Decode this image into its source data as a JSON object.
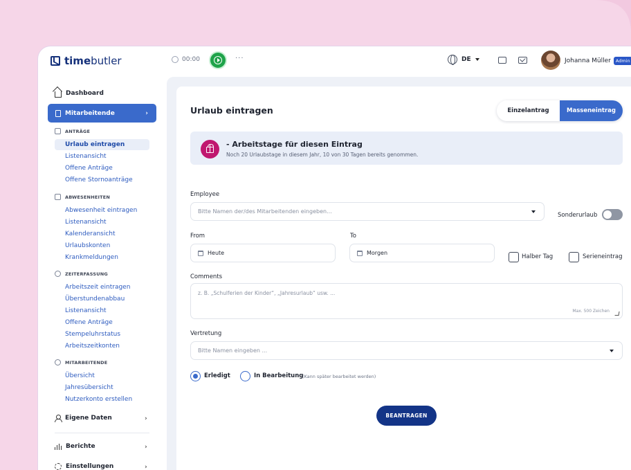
{
  "brand": {
    "bold": "time",
    "light": "butler"
  },
  "header": {
    "timer": "00:00",
    "more": "···",
    "language": "DE",
    "user_name": "Johanna Müller",
    "user_badge": "Admin"
  },
  "sidebar": {
    "dashboard": "Dashboard",
    "active": "Mitarbeitende",
    "sections": {
      "antraege": {
        "title": "ANTRÄGE",
        "items": [
          "Urlaub eintragen",
          "Listenansicht",
          "Offene Anträge",
          "Offene Stornoanträge"
        ]
      },
      "abwesenheiten": {
        "title": "ABWESENHEITEN",
        "items": [
          "Abwesenheit eintragen",
          "Listenansicht",
          "Kalenderansicht",
          "Urlaubskonten",
          "Krankmeldungen"
        ]
      },
      "zeiterfassung": {
        "title": "ZEITERFASSUNG",
        "items": [
          "Arbeitszeit eintragen",
          "Überstundenabbau",
          "Listenansicht",
          "Offene Anträge",
          "Stempeluhrstatus",
          "Arbeitszeitkonten"
        ]
      },
      "mitarbeitende": {
        "title": "MITARBEITENDE",
        "items": [
          "Übersicht",
          "Jahresübersicht",
          "Nutzerkonto erstellen"
        ]
      }
    },
    "eigene_daten": "Eigene Daten",
    "berichte": "Berichte",
    "einstellungen": "Einstellungen"
  },
  "main": {
    "title": "Urlaub eintragen",
    "toggle": {
      "single": "Einzelantrag",
      "mass": "Masseneintrag"
    },
    "info": {
      "title": "- Arbeitstage für diesen Eintrag",
      "text": "Noch 20 Urlaubstage in diesem Jahr, 10 von 30 Tagen bereits genommen."
    },
    "employee": {
      "label": "Employee",
      "placeholder": "Bitte Namen der/des Mitarbeitenden eingeben..."
    },
    "sonderurlaub": "Sonderurlaub",
    "from": {
      "label": "From",
      "value": "Heute"
    },
    "to": {
      "label": "To",
      "value": "Morgen"
    },
    "halber_tag": "Halber Tag",
    "serieneintrag": "Serieneintrag",
    "comments": {
      "label": "Comments",
      "placeholder": "z. B. „Schulferien der Kinder“, „Jahresurlaub“ usw. ...",
      "max": "Max. 500 Zeichen"
    },
    "vertretung": {
      "label": "Vertretung",
      "placeholder": "Bitte Namen eingeben ..."
    },
    "status": {
      "done": "Erledigt",
      "in_progress": "In Bearbeitung",
      "note": "(Kann später bearbeitet werden)"
    },
    "submit": "BEANTRAGEN"
  },
  "colors": {
    "accent": "#3a6acb",
    "submit": "#133487",
    "gift": "#c0186f",
    "timer": "#1fa34a",
    "background": "#f2c9e0"
  }
}
